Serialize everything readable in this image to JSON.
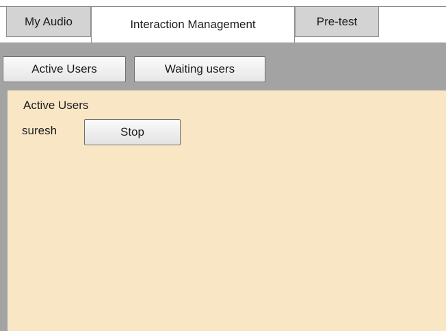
{
  "top_tabs": [
    {
      "label": "My Audio",
      "active": false
    },
    {
      "label": "Interaction Management",
      "active": true
    },
    {
      "label": "Pre-test",
      "active": false
    }
  ],
  "sub_tabs": [
    {
      "label": "Active Users"
    },
    {
      "label": "Waiting users"
    }
  ],
  "panel": {
    "title": "Active Users",
    "users": [
      {
        "name": "suresh",
        "action_label": "Stop"
      }
    ]
  },
  "colors": {
    "panel_background": "#f9e6c5",
    "toolbar_background": "#a3a3a3",
    "inactive_tab": "#d3d3d3"
  }
}
